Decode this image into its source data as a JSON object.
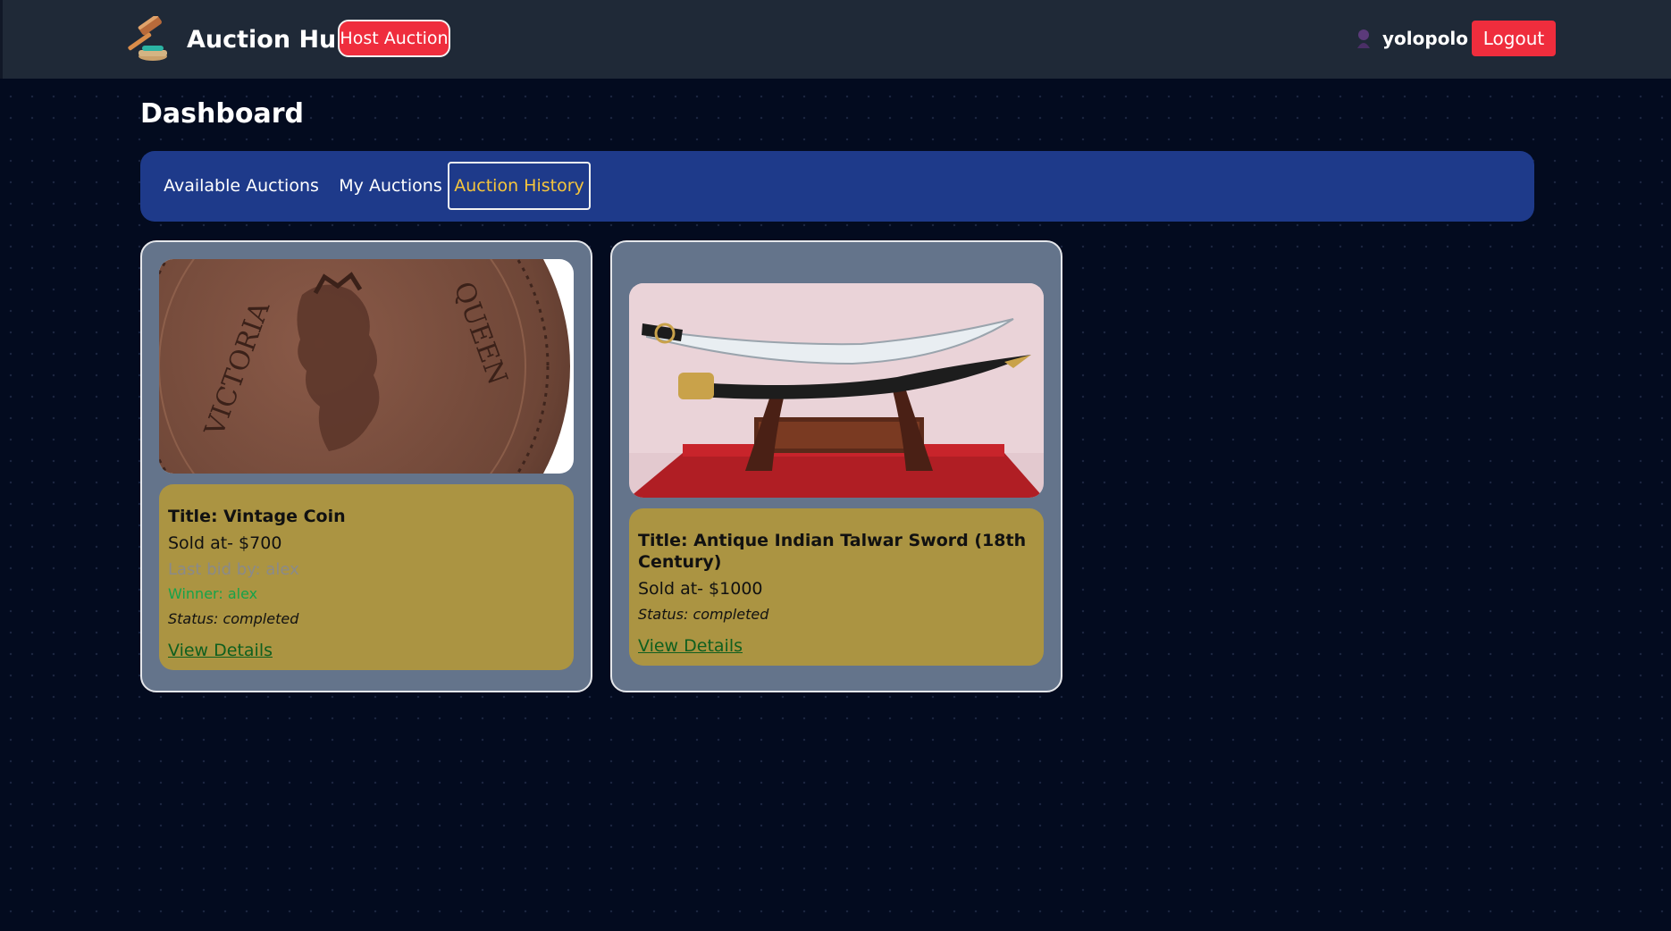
{
  "header": {
    "app_name": "Auction Hub",
    "host_button_label": "Host Auction",
    "username": "yolopolo",
    "logout_label": "Logout"
  },
  "page": {
    "title": "Dashboard"
  },
  "tabs": [
    {
      "label": "Available Auctions",
      "active": false
    },
    {
      "label": "My Auctions",
      "active": false
    },
    {
      "label": "Auction History",
      "active": true
    }
  ],
  "auctions": [
    {
      "title": "Title: Vintage Coin",
      "sold_at": "Sold at- $700",
      "last_bid": "Last bid by: alex",
      "winner": "Winner: alex",
      "status": "Status: completed",
      "link_label": "View Details",
      "image_icon": "victoria-coin-photo"
    },
    {
      "title": "Title: Antique Indian Talwar Sword (18th Century)",
      "sold_at": "Sold at- $1000",
      "status": "Status: completed",
      "link_label": "View Details",
      "image_icon": "talwar-sword-photo"
    }
  ],
  "colors": {
    "background": "#030b1f",
    "topbar": "#1f2937",
    "accent_red": "#ef2d3d",
    "tabbar": "#1e3a8a",
    "active_tab_text": "#f5c53d",
    "card": "#64748b",
    "info_panel": "#ab9442",
    "winner_green": "#16a34a",
    "link_green": "#0f5f1f"
  }
}
